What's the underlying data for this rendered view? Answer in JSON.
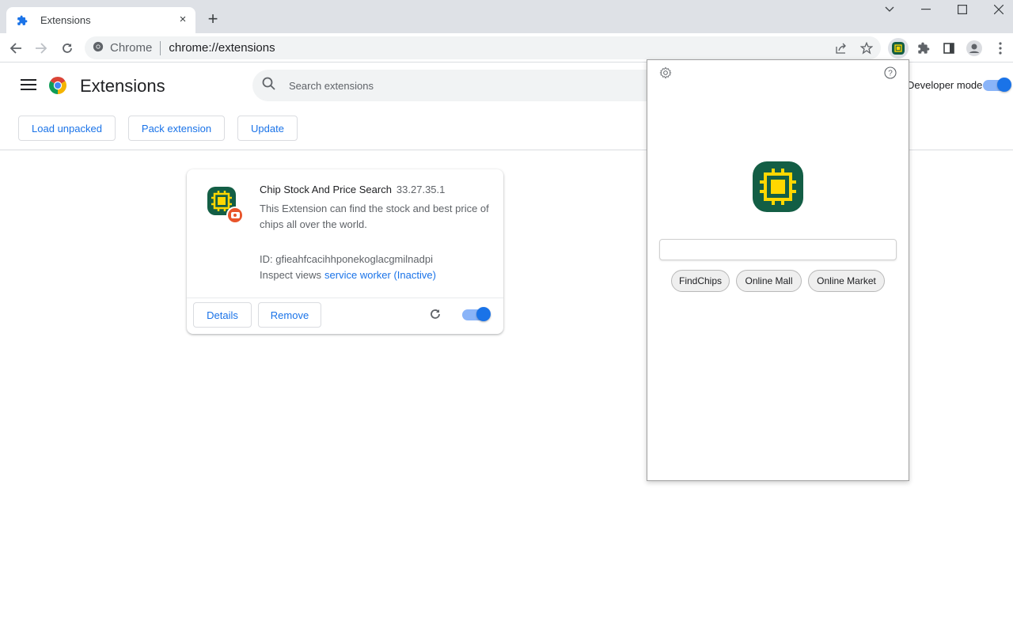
{
  "browser": {
    "tab": {
      "title": "Extensions",
      "close_glyph": "×"
    },
    "new_tab_glyph": "+",
    "omnibox": {
      "site": "Chrome",
      "url": "chrome://extensions"
    }
  },
  "page": {
    "title": "Extensions",
    "search": {
      "placeholder": "Search extensions"
    },
    "developer_mode": {
      "label": "Developer mode",
      "enabled": true
    },
    "actions": [
      "Load unpacked",
      "Pack extension",
      "Update"
    ]
  },
  "extension": {
    "name": "Chip Stock And Price Search",
    "version": "33.27.35.1",
    "description": "This Extension can find the stock and best price of chips all over the world.",
    "id_text": "ID: gfieahfcacihhponekoglacgmilnadpi",
    "inspect_label": "Inspect views",
    "inspect_link": "service worker (Inactive)",
    "details_label": "Details",
    "remove_label": "Remove",
    "enabled": true
  },
  "popup": {
    "input_value": "",
    "buttons": [
      "FindChips",
      "Online Mall",
      "Online Market"
    ]
  },
  "colors": {
    "accent": "#1a73e8",
    "icon_bg": "#135e45",
    "icon_fg": "#ffd700"
  }
}
